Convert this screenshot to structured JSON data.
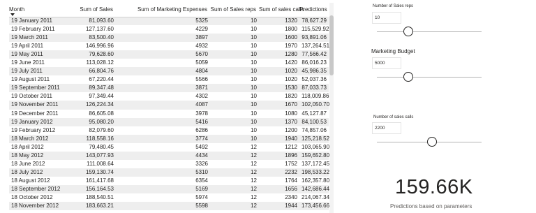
{
  "table": {
    "headers": [
      "Month",
      "Sum of Sales",
      "Sum of Marketing Expenses",
      "Sum of Sales reps",
      "Sum of sales calls",
      "Predictions"
    ],
    "rows": [
      [
        "19 January 2011",
        "81,093.60",
        "5325",
        "10",
        "1320",
        "78,627.29"
      ],
      [
        "19 February 2011",
        "127,137.60",
        "4229",
        "10",
        "1800",
        "115,529.92"
      ],
      [
        "19 March 2011",
        "83,500.40",
        "3897",
        "10",
        "1600",
        "93,891.06"
      ],
      [
        "19 April 2011",
        "146,996.96",
        "4932",
        "10",
        "1970",
        "137,264.51"
      ],
      [
        "19 May 2011",
        "79,628.60",
        "5670",
        "10",
        "1280",
        "77,566.42"
      ],
      [
        "19 June 2011",
        "113,028.12",
        "5059",
        "10",
        "1420",
        "86,016.23"
      ],
      [
        "19 July 2011",
        "66,804.76",
        "4804",
        "10",
        "1020",
        "45,986.35"
      ],
      [
        "19 August 2011",
        "67,220.44",
        "5566",
        "10",
        "1020",
        "52,037.36"
      ],
      [
        "19 September 2011",
        "89,347.48",
        "3871",
        "10",
        "1530",
        "87,033.73"
      ],
      [
        "19 October 2011",
        "97,349.44",
        "4302",
        "10",
        "1820",
        "118,009.86"
      ],
      [
        "19 November 2011",
        "126,224.34",
        "4087",
        "10",
        "1670",
        "102,050.70"
      ],
      [
        "19 December 2011",
        "86,605.08",
        "3978",
        "10",
        "1080",
        "45,127.87"
      ],
      [
        "19 January 2012",
        "95,080.20",
        "5416",
        "10",
        "1370",
        "84,100.53"
      ],
      [
        "19 February 2012",
        "82,079.60",
        "6286",
        "10",
        "1200",
        "74,857.06"
      ],
      [
        "18 March 2012",
        "118,558.16",
        "3774",
        "10",
        "1940",
        "125,218.52"
      ],
      [
        "18 April 2012",
        "79,480.45",
        "5492",
        "12",
        "1212",
        "103,065.90"
      ],
      [
        "18 May 2012",
        "143,077.93",
        "4434",
        "12",
        "1896",
        "159,652.80"
      ],
      [
        "18 June 2012",
        "111,008.64",
        "3326",
        "12",
        "1752",
        "137,172.45"
      ],
      [
        "18 July 2012",
        "159,130.74",
        "5310",
        "12",
        "2232",
        "198,533.22"
      ],
      [
        "18 August 2012",
        "161,417.68",
        "6354",
        "12",
        "1764",
        "162,357.80"
      ],
      [
        "18 September 2012",
        "156,164.53",
        "5169",
        "12",
        "1656",
        "142,686.44"
      ],
      [
        "18 October 2012",
        "188,540.51",
        "5974",
        "12",
        "2340",
        "214,067.34"
      ],
      [
        "18 November 2012",
        "183,663.21",
        "5598",
        "12",
        "1944",
        "173,456.66"
      ]
    ]
  },
  "params": {
    "sales_reps": {
      "label": "Number of Sales reps",
      "value": "10"
    },
    "marketing_budget": {
      "label": "Marketing Budget",
      "value": "5000"
    },
    "sales_calls": {
      "label": "Number of sales calls",
      "value": "2200"
    }
  },
  "kpi": {
    "value": "159.66K",
    "caption": "Predictions based on parameters"
  },
  "colors": {
    "row_stripe": "#eeeeee",
    "text": "#252423",
    "caption": "#605e5c"
  }
}
